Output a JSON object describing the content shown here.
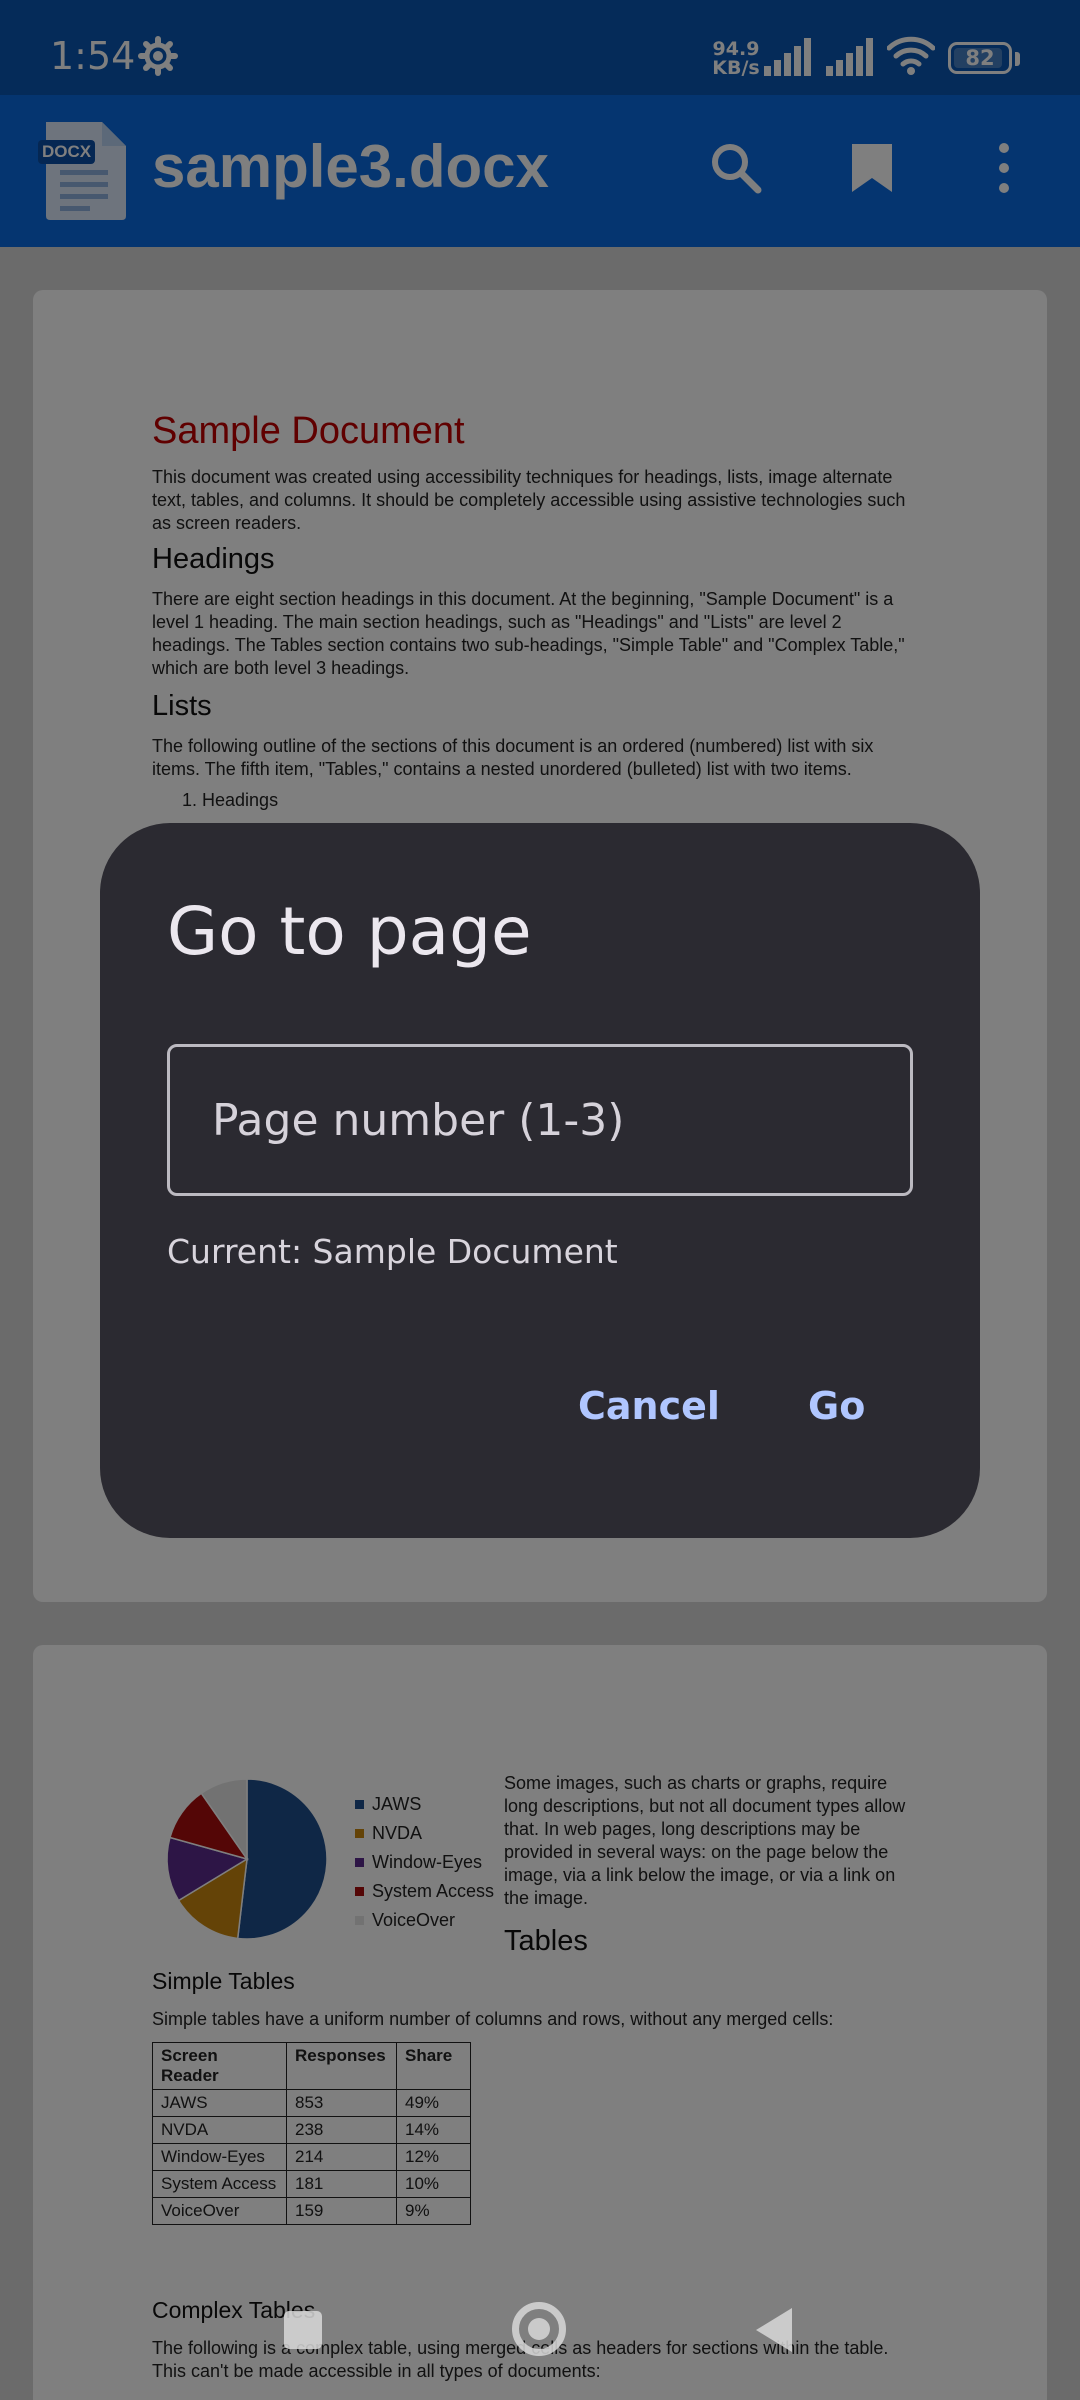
{
  "status_bar": {
    "time": "1:54",
    "net_speed_value": "94.9",
    "net_speed_unit": "KB/s",
    "battery": "82"
  },
  "app_bar": {
    "file_badge": "DOCX",
    "title": "sample3.docx"
  },
  "document": {
    "page1": {
      "title": "Sample Document",
      "intro": "This document was created using accessibility techniques for headings, lists, image alternate text, tables, and columns. It should be completely accessible using assistive technologies such as screen readers.",
      "headings_title": "Headings",
      "headings_text": "There are eight section headings in this document. At the beginning, \"Sample Document\" is a level 1 heading. The main section headings, such as \"Headings\" and \"Lists\" are level 2 headings. The Tables section contains two sub-headings, \"Simple Table\" and \"Complex Table,\" which are both level 3 headings.",
      "lists_title": "Lists",
      "lists_text": "The following outline of the sections of this document is an ordered (numbered) list with six items. The fifth item, \"Tables,\" contains a nested unordered (bulleted) list with two items.",
      "list_item_1": "1. Headings"
    },
    "page2": {
      "images_text": "Some images, such as charts or graphs, require long descriptions, but not all document types allow that. In web pages, long descriptions may be provided in several ways: on the page below the image, via a link below the image, or via a link on the image.",
      "tables_title": "Tables",
      "simple_tables_title": "Simple Tables",
      "simple_tables_text": "Simple tables have a uniform number of columns and rows, without any merged cells:",
      "table_headers": [
        "Screen Reader",
        "Responses",
        "Share"
      ],
      "table_rows": [
        [
          "JAWS",
          "853",
          "49%"
        ],
        [
          "NVDA",
          "238",
          "14%"
        ],
        [
          "Window-Eyes",
          "214",
          "12%"
        ],
        [
          "System Access",
          "181",
          "10%"
        ],
        [
          "VoiceOver",
          "159",
          "9%"
        ]
      ],
      "complex_tables_title": "Complex Tables",
      "complex_tables_text": "The following is a complex table, using merged cells as headers for sections within the table. This can't be made accessible in all types of documents:"
    }
  },
  "chart_data": {
    "type": "pie",
    "categories": [
      "JAWS",
      "NVDA",
      "Window-Eyes",
      "System Access",
      "VoiceOver"
    ],
    "values": [
      853,
      238,
      214,
      181,
      159
    ],
    "colors": [
      "#1f4e8c",
      "#c8870e",
      "#5b2a8c",
      "#a80d0d",
      "#e4e4e4"
    ],
    "legend_position": "right"
  },
  "dialog": {
    "title": "Go to page",
    "input_placeholder": "Page number (1-3)",
    "current": "Current: Sample Document",
    "cancel": "Cancel",
    "go": "Go"
  }
}
